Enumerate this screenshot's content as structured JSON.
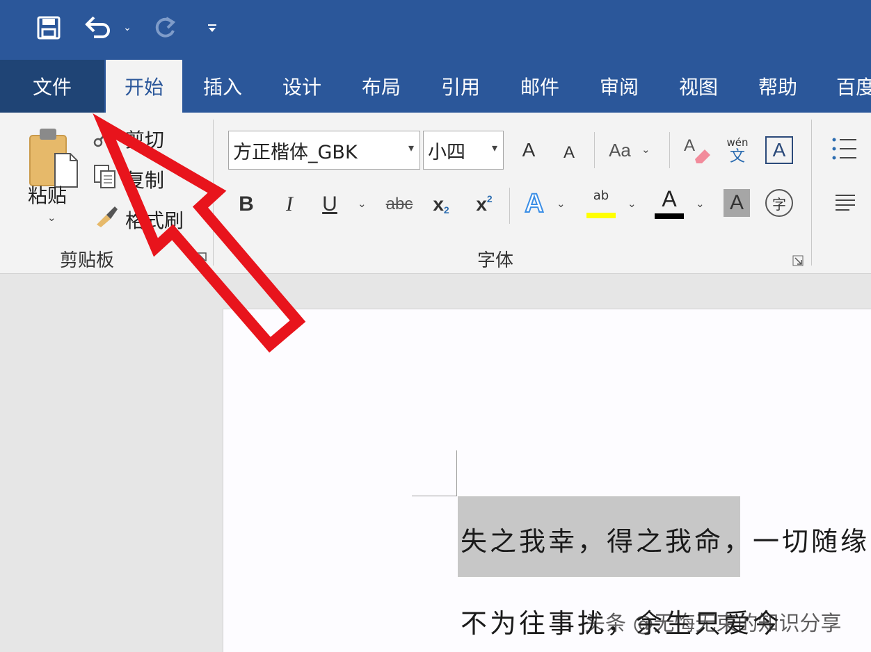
{
  "quick_access": {
    "save_icon": "save-icon",
    "undo_icon": "undo-icon",
    "redo_icon": "redo-icon",
    "customize_icon": "customize-dropdown-icon"
  },
  "tabs": [
    {
      "label": "文件"
    },
    {
      "label": "开始"
    },
    {
      "label": "插入"
    },
    {
      "label": "设计"
    },
    {
      "label": "布局"
    },
    {
      "label": "引用"
    },
    {
      "label": "邮件"
    },
    {
      "label": "审阅"
    },
    {
      "label": "视图"
    },
    {
      "label": "帮助"
    },
    {
      "label": "百度"
    }
  ],
  "clipboard": {
    "paste_label": "粘贴",
    "cut_label": "剪切",
    "copy_label": "复制",
    "format_painter_label": "格式刷",
    "group_label": "剪贴板"
  },
  "font": {
    "font_name": "方正楷体_GBK",
    "font_size": "小四",
    "grow_label": "A",
    "shrink_label": "A",
    "change_case_label": "Aa",
    "phonetic_top": "wén",
    "phonetic_bottom": "文",
    "border_label": "A",
    "bold_label": "B",
    "italic_label": "I",
    "underline_label": "U",
    "strike_label": "abc",
    "subscript_label": "x",
    "subscript_mark": "2",
    "superscript_label": "x",
    "superscript_mark": "2",
    "text_effect_label": "A",
    "highlight_label": "ab",
    "font_color_label": "A",
    "shading_label": "A",
    "enclose_label": "字",
    "group_label": "字体"
  },
  "colors": {
    "title_bar": "#2b579a",
    "highlight": "#ffff00",
    "font_color": "#000000",
    "arrow": "#e8141c",
    "selection": "#c7c7c7"
  },
  "document": {
    "line1_selected": "失之我幸，得之我命",
    "line1_rest": "，一切随缘",
    "line2": "不为往事扰，余生只爱今",
    "watermark": "头条 @无悔无束的知识分享"
  }
}
